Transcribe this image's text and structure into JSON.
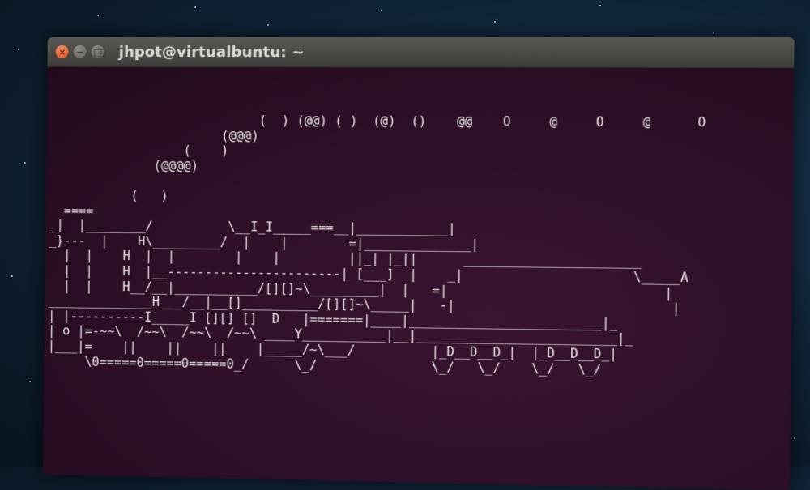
{
  "window": {
    "title": "jhpot@virtualbuntu: ~",
    "controls": {
      "close_glyph": "×",
      "minimize_glyph": "−",
      "maximize_glyph": "□"
    }
  },
  "terminal": {
    "lines": [
      "                            (  ) (@@) ( )  (@)  ()    @@    O     @     O     @      O",
      "                       (@@@)",
      "                  (    )",
      "              (@@@@)",
      "",
      "           (   )",
      "  ====",
      "_|  |________/          \\__I_I_____===__|____________|",
      "_}---  |    H\\_________/  |    |        =|______________|",
      "  |  |    H  |  |        |    |         ||_| |_||      _______________________",
      "  |  |    H  |__-----------------------| [___]  |    _|                      \\_____A",
      "  |  |    H__/__|___________/[][]~\\_________|  |   =|                            |",
      "______________H___/__|__[]__________/[][]~\\_____|   -|                            |",
      "| |----------I_____I [][] []  D   |=======|____|_________________________|_",
      "| o |=-~~\\  /~~\\  /~~\\  /~~\\ ____Y___________|__|__________________________|_",
      "|___|=    ||    ||    ||    |_____/~\\___/          |_D__D__D_|  |_D__D__D_|",
      "     \\0=====0=====0=====0_/      \\_/               \\_/   \\_/    \\_/   \\_/"
    ]
  }
}
